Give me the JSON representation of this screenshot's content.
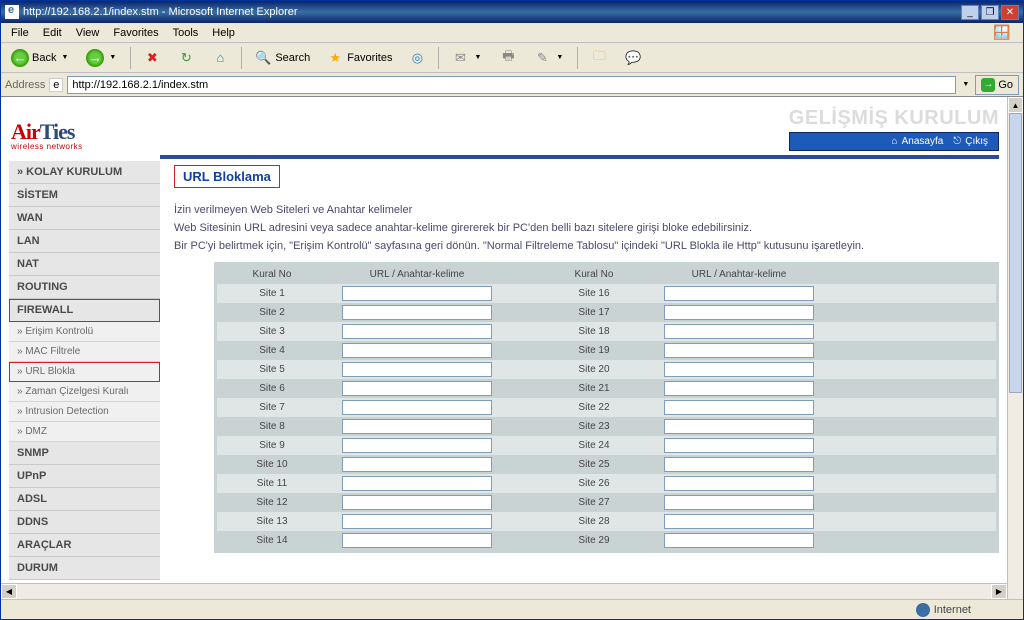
{
  "window": {
    "title": "http://192.168.2.1/index.stm - Microsoft Internet Explorer"
  },
  "menus": {
    "file": "File",
    "edit": "Edit",
    "view": "View",
    "favorites": "Favorites",
    "tools": "Tools",
    "help": "Help"
  },
  "toolbar": {
    "back": "Back",
    "search": "Search",
    "favorites": "Favorites"
  },
  "addressbar": {
    "label": "Address",
    "url": "http://192.168.2.1/index.stm",
    "go": "Go"
  },
  "header": {
    "logo_a": "Air",
    "logo_b": "Ties",
    "logo_sub": "wireless networks",
    "title": "GELİŞMİŞ KURULUM",
    "link_home": "Anasayfa",
    "link_logout": "Çıkış"
  },
  "sidebar": {
    "kolay": "» KOLAY KURULUM",
    "sistem": "SİSTEM",
    "wan": "WAN",
    "lan": "LAN",
    "nat": "NAT",
    "routing": "ROUTING",
    "firewall": "FIREWALL",
    "s_erisim": "» Erişim Kontrolü",
    "s_mac": "» MAC Filtrele",
    "s_url": "» URL Blokla",
    "s_zaman": "» Zaman Çizelgesi Kuralı",
    "s_ids": "» Intrusion Detection",
    "s_dmz": "» DMZ",
    "snmp": "SNMP",
    "upnp": "UPnP",
    "adsl": "ADSL",
    "ddns": "DDNS",
    "araclar": "ARAÇLAR",
    "durum": "DURUM"
  },
  "page": {
    "title": "URL Bloklama",
    "p1": "İzin verilmeyen Web Siteleri ve Anahtar kelimeler",
    "p2": "Web Sitesinin URL adresini veya sadece anahtar-kelime girererek bir PC'den belli bazı sitelere girişi bloke edebilirsiniz.",
    "p3": "Bir PC'yi belirtmek için, \"Erişim Kontrolü\" sayfasına geri dönün. \"Normal Filtreleme Tablosu\" içindeki \"URL Blokla ile Http\" kutusunu işaretleyin.",
    "col1": "Kural No",
    "col2": "URL / Anahtar-kelime",
    "col3": "Kural No",
    "col4": "URL / Anahtar-kelime",
    "rows_left": [
      "Site 1",
      "Site 2",
      "Site 3",
      "Site 4",
      "Site 5",
      "Site 6",
      "Site 7",
      "Site 8",
      "Site 9",
      "Site 10",
      "Site 11",
      "Site 12",
      "Site 13",
      "Site 14"
    ],
    "rows_right": [
      "Site 16",
      "Site 17",
      "Site 18",
      "Site 19",
      "Site 20",
      "Site 21",
      "Site 22",
      "Site 23",
      "Site 24",
      "Site 25",
      "Site 26",
      "Site 27",
      "Site 28",
      "Site 29"
    ]
  },
  "statusbar": {
    "done": "",
    "zone": "Internet"
  }
}
